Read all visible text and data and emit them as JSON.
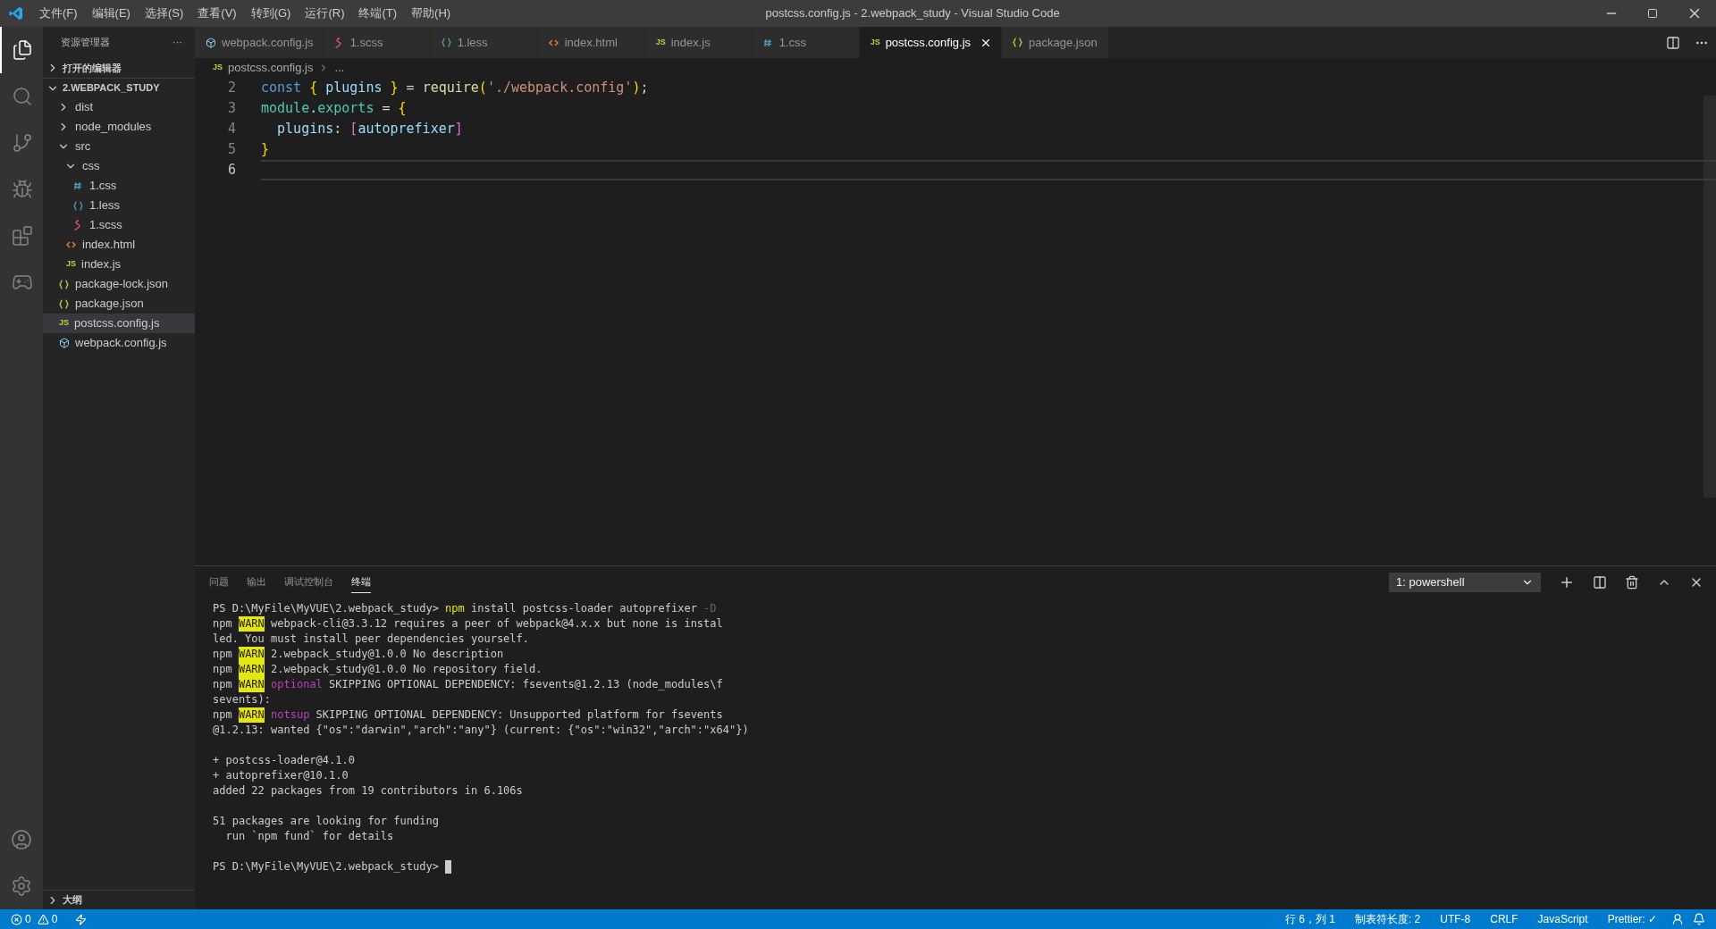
{
  "menu": [
    "文件(F)",
    "编辑(E)",
    "选择(S)",
    "查看(V)",
    "转到(G)",
    "运行(R)",
    "终端(T)",
    "帮助(H)"
  ],
  "window": {
    "title": "postcss.config.js - 2.webpack_study - Visual Studio Code"
  },
  "activity_bar": [
    {
      "kind": "files",
      "selected": true
    },
    {
      "kind": "search",
      "selected": false
    },
    {
      "kind": "git",
      "selected": false
    },
    {
      "kind": "debug",
      "selected": false
    },
    {
      "kind": "extensions",
      "selected": false
    },
    {
      "kind": "gamepad",
      "selected": false
    }
  ],
  "sidebar": {
    "title": "资源管理器",
    "more": "···",
    "open_editors": {
      "label": "打开的编辑器",
      "expanded": false
    },
    "project": {
      "label": "2.WEBPACK_STUDY",
      "expanded": true
    },
    "items": [
      {
        "label": "dist",
        "kind": "folder",
        "expanded": false,
        "selected": false
      },
      {
        "label": "node_modules",
        "kind": "folder",
        "expanded": false,
        "selected": false
      },
      {
        "label": "src",
        "kind": "folder",
        "expanded": true,
        "selected": false,
        "children": [
          {
            "label": "css",
            "kind": "folder",
            "expanded": true,
            "selected": false,
            "children": [
              {
                "label": "1.css",
                "kind": "css",
                "selected": false
              },
              {
                "label": "1.less",
                "kind": "less",
                "selected": false
              },
              {
                "label": "1.scss",
                "kind": "scss",
                "selected": false
              }
            ]
          },
          {
            "label": "index.html",
            "kind": "html",
            "selected": false
          },
          {
            "label": "index.js",
            "kind": "js",
            "icon_text": "JS",
            "selected": false
          }
        ]
      },
      {
        "label": "package-lock.json",
        "kind": "json",
        "selected": false
      },
      {
        "label": "package.json",
        "kind": "json",
        "selected": false
      },
      {
        "label": "postcss.config.js",
        "kind": "js",
        "icon_text": "JS",
        "selected": true
      },
      {
        "label": "webpack.config.js",
        "kind": "webpack",
        "selected": false
      }
    ],
    "outline": {
      "label": "大纲",
      "expanded": false
    }
  },
  "tabs": [
    {
      "label": "webpack.config.js",
      "kind": "webpack",
      "selected": false
    },
    {
      "label": "1.scss",
      "kind": "scss",
      "selected": false
    },
    {
      "label": "1.less",
      "kind": "less",
      "selected": false
    },
    {
      "label": "index.html",
      "kind": "html",
      "selected": false
    },
    {
      "label": "index.js",
      "kind": "js",
      "icon_text": "JS",
      "selected": false
    },
    {
      "label": "1.css",
      "kind": "css",
      "selected": false
    },
    {
      "label": "postcss.config.js",
      "kind": "js",
      "icon_text": "JS",
      "selected": true
    },
    {
      "label": "package.json",
      "kind": "json",
      "selected": false
    }
  ],
  "breadcrumb": {
    "file": "postcss.config.js",
    "kind": "js",
    "icon_text": "JS",
    "rest": "..."
  },
  "code": [
    {
      "number": "2",
      "current": false,
      "tokens": [
        {
          "t": "const",
          "kind": "keyword"
        },
        {
          "t": " {",
          "kind": "brace"
        },
        {
          "t": " plugins",
          "kind": "var"
        },
        {
          "t": " }",
          "kind": "brace"
        },
        {
          "t": " = ",
          "kind": "plain"
        },
        {
          "t": "require",
          "kind": "func"
        },
        {
          "t": "(",
          "kind": "brace"
        },
        {
          "t": "'./webpack.config'",
          "kind": "string"
        },
        {
          "t": ")",
          "kind": "brace"
        },
        {
          "t": ";",
          "kind": "plain"
        }
      ]
    },
    {
      "number": "3",
      "current": false,
      "tokens": [
        {
          "t": "module",
          "kind": "type"
        },
        {
          "t": ".",
          "kind": "plain"
        },
        {
          "t": "exports",
          "kind": "type"
        },
        {
          "t": " = ",
          "kind": "plain"
        },
        {
          "t": "{",
          "kind": "brace"
        }
      ]
    },
    {
      "number": "4",
      "current": false,
      "tokens": [
        {
          "t": "  plugins",
          "kind": "var"
        },
        {
          "t": ": ",
          "kind": "plain"
        },
        {
          "t": "[",
          "kind": "bracket"
        },
        {
          "t": "autoprefixer",
          "kind": "var"
        },
        {
          "t": "]",
          "kind": "bracket"
        }
      ]
    },
    {
      "number": "5",
      "current": false,
      "tokens": [
        {
          "t": "}",
          "kind": "brace"
        }
      ]
    },
    {
      "number": "6",
      "current": true
    }
  ],
  "panel": {
    "tabs": [
      {
        "label": "问题",
        "selected": false
      },
      {
        "label": "输出",
        "selected": false
      },
      {
        "label": "调试控制台",
        "selected": false
      },
      {
        "label": "终端",
        "selected": true
      }
    ],
    "terminal_select": "1: powershell",
    "terminal": [
      {
        "kind": "text",
        "segments": [
          {
            "t": "PS D:\\MyFile\\MyVUE\\2.webpack_study> ",
            "kind": "plain"
          },
          {
            "t": "npm",
            "kind": "cmd"
          },
          {
            "t": " install postcss-loader autoprefixer ",
            "kind": "plain"
          },
          {
            "t": "-D",
            "kind": "flag"
          }
        ]
      },
      {
        "kind": "text",
        "segments": [
          {
            "t": "npm ",
            "kind": "plain"
          },
          {
            "t": "WARN",
            "kind": "warn"
          },
          {
            "t": " webpack-cli@3.3.12 requires a peer of webpack@4.x.x but none is instal",
            "kind": "plain"
          }
        ]
      },
      {
        "kind": "text",
        "segments": [
          {
            "t": "led. You must install peer dependencies yourself.",
            "kind": "plain"
          }
        ]
      },
      {
        "kind": "text",
        "segments": [
          {
            "t": "npm ",
            "kind": "plain"
          },
          {
            "t": "WARN",
            "kind": "warn"
          },
          {
            "t": " 2.webpack_study@1.0.0 No description",
            "kind": "plain"
          }
        ]
      },
      {
        "kind": "text",
        "segments": [
          {
            "t": "npm ",
            "kind": "plain"
          },
          {
            "t": "WARN",
            "kind": "warn"
          },
          {
            "t": " 2.webpack_study@1.0.0 No repository field.",
            "kind": "plain"
          }
        ]
      },
      {
        "kind": "text",
        "segments": [
          {
            "t": "npm ",
            "kind": "plain"
          },
          {
            "t": "WARN",
            "kind": "warn"
          },
          {
            "t": " optional",
            "kind": "magenta"
          },
          {
            "t": " SKIPPING OPTIONAL DEPENDENCY: fsevents@1.2.13 (node_modules\\f",
            "kind": "plain"
          }
        ]
      },
      {
        "kind": "text",
        "segments": [
          {
            "t": "sevents):",
            "kind": "plain"
          }
        ]
      },
      {
        "kind": "text",
        "segments": [
          {
            "t": "npm ",
            "kind": "plain"
          },
          {
            "t": "WARN",
            "kind": "warn"
          },
          {
            "t": " notsup",
            "kind": "magenta"
          },
          {
            "t": " SKIPPING OPTIONAL DEPENDENCY: Unsupported platform for fsevents",
            "kind": "plain"
          }
        ]
      },
      {
        "kind": "text",
        "segments": [
          {
            "t": "@1.2.13: wanted {\"os\":\"darwin\",\"arch\":\"any\"} (current: {\"os\":\"win32\",\"arch\":\"x64\"})",
            "kind": "plain"
          }
        ]
      },
      {
        "kind": "blank"
      },
      {
        "kind": "text",
        "segments": [
          {
            "t": "+ postcss-loader@4.1.0",
            "kind": "plain"
          }
        ]
      },
      {
        "kind": "text",
        "segments": [
          {
            "t": "+ autoprefixer@10.1.0",
            "kind": "plain"
          }
        ]
      },
      {
        "kind": "text",
        "segments": [
          {
            "t": "added 22 packages from 19 contributors in 6.106s",
            "kind": "plain"
          }
        ]
      },
      {
        "kind": "blank"
      },
      {
        "kind": "text",
        "segments": [
          {
            "t": "51 packages are looking for funding",
            "kind": "plain"
          }
        ]
      },
      {
        "kind": "text",
        "segments": [
          {
            "t": "  run `npm fund` for details",
            "kind": "plain"
          }
        ]
      },
      {
        "kind": "blank"
      },
      {
        "kind": "text",
        "segments": [
          {
            "t": "PS D:\\MyFile\\MyVUE\\2.webpack_study> ",
            "kind": "plain"
          },
          {
            "kind": "cursor"
          }
        ]
      }
    ]
  },
  "status_bar": {
    "errors": "0",
    "warnings": "0",
    "right": [
      "行 6，列 1",
      "制表符长度: 2",
      "UTF-8",
      "CRLF",
      "JavaScript",
      "Prettier: ✓"
    ]
  }
}
